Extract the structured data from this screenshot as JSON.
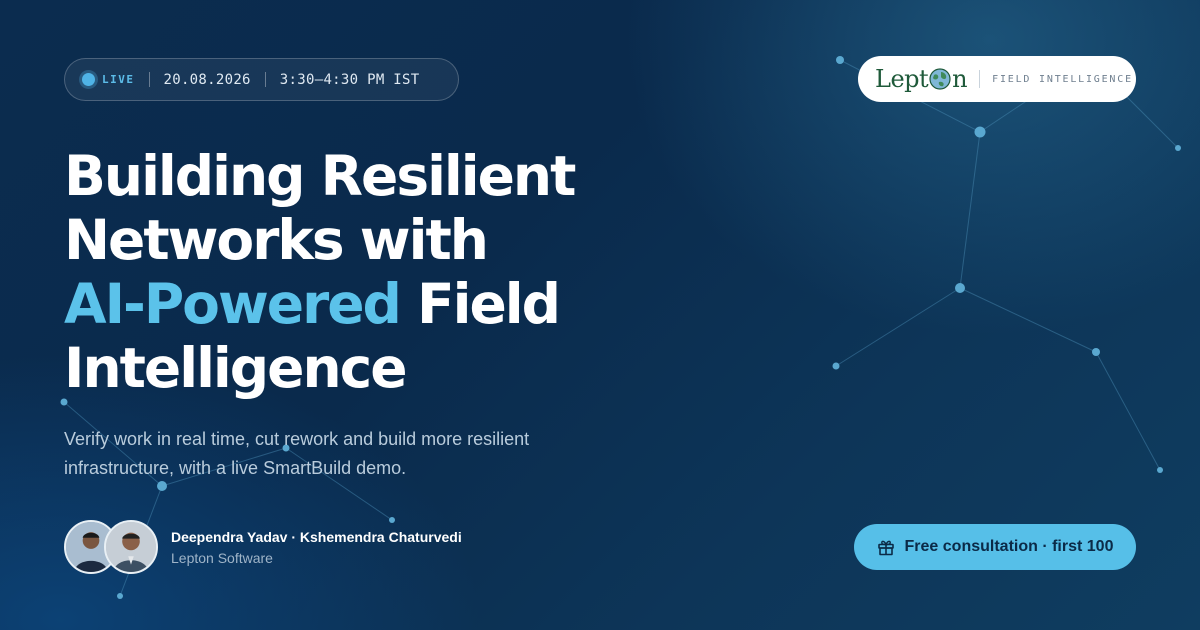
{
  "event": {
    "live_label": "LIVE",
    "date": "20.08.2026",
    "time": "3:30–4:30 PM IST"
  },
  "headline": {
    "line1": "Building Resilient",
    "line2": "Networks with",
    "accent": "AI-Powered",
    "line3_rest": " Field",
    "line4": "Intelligence"
  },
  "subtitle": "Verify work in real time, cut rework and build more resilient infrastructure, with a live SmartBuild demo.",
  "speakers": {
    "names": "Deependra Yadav · Kshemendra Chaturvedi",
    "company": "Lepton Software",
    "avatar_icons": [
      "person-photo",
      "person-photo"
    ]
  },
  "logo": {
    "word_prefix": "Lept",
    "word_suffix": "n",
    "tagline": "FIELD INTELLIGENCE",
    "brand_color": "#1f5a3a"
  },
  "cta": {
    "label": "Free consultation · first 100",
    "icon": "gift-icon"
  },
  "colors": {
    "accent": "#5bc2ea",
    "background": "#0b2c4f",
    "cta_bg": "#56bfe8"
  }
}
